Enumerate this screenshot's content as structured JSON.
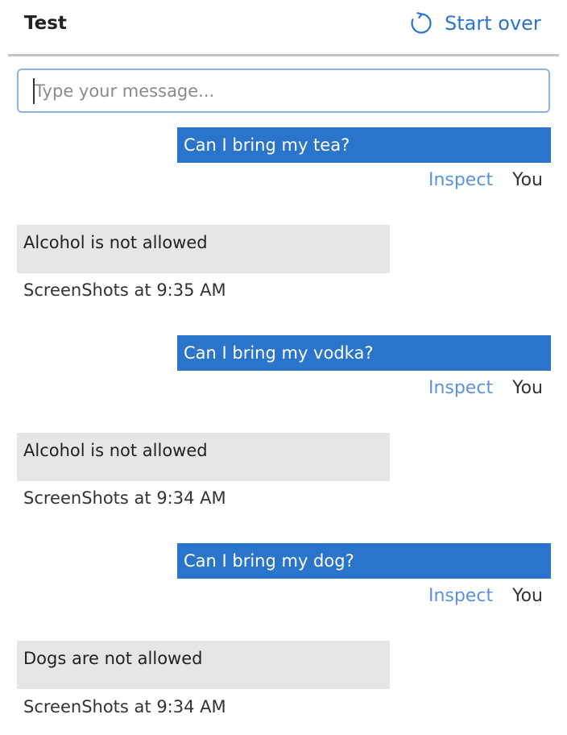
{
  "header": {
    "title": "Test",
    "start_over_label": "Start over",
    "start_over_icon": "refresh-icon",
    "accent_color": "#2b74cc"
  },
  "input": {
    "placeholder": "Type your message...",
    "value": ""
  },
  "messages": [
    {
      "role": "user",
      "text": "Can I bring my tea?",
      "inspect_label": "Inspect",
      "sender_label": "You"
    },
    {
      "role": "bot",
      "text": "Alcohol is not allowed",
      "meta": "ScreenShots at 9:35 AM"
    },
    {
      "role": "user",
      "text": "Can I bring my vodka?",
      "inspect_label": "Inspect",
      "sender_label": "You"
    },
    {
      "role": "bot",
      "text": "Alcohol is not allowed",
      "meta": "ScreenShots at 9:34 AM"
    },
    {
      "role": "user",
      "text": "Can I bring my dog?",
      "inspect_label": "Inspect",
      "sender_label": "You"
    },
    {
      "role": "bot",
      "text": "Dogs are not allowed",
      "meta": "ScreenShots at 9:34 AM"
    }
  ],
  "colors": {
    "user_bubble": "#2b74cc",
    "bot_bubble": "#e6e6e6",
    "link": "#5a92dc",
    "divider": "#c3c3c3",
    "input_border": "#8db4e8"
  }
}
